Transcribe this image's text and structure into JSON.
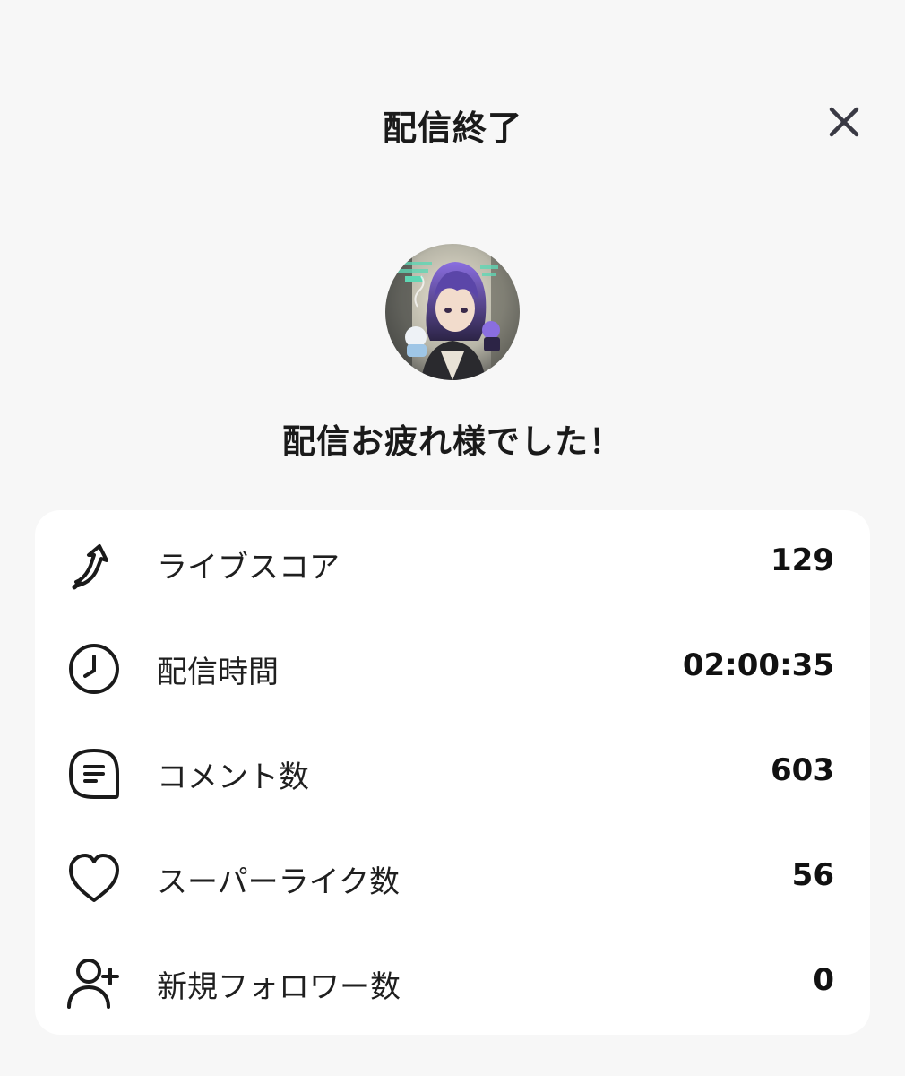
{
  "header": {
    "title": "配信終了",
    "close_icon": "close-icon"
  },
  "avatar": {
    "description_icon": "avatar-image",
    "colors": [
      "#7b5fd6",
      "#2b2440",
      "#c9d8d0",
      "#e9e4d6"
    ]
  },
  "message": "配信お疲れ様でした！",
  "stats": [
    {
      "icon": "live-score-arrow-icon",
      "label": "ライブスコア",
      "value": "129"
    },
    {
      "icon": "clock-icon",
      "label": "配信時間",
      "value": "02:00:35"
    },
    {
      "icon": "comment-icon",
      "label": "コメント数",
      "value": "603"
    },
    {
      "icon": "heart-icon",
      "label": "スーパーライク数",
      "value": "56"
    },
    {
      "icon": "add-user-icon",
      "label": "新規フォロワー数",
      "value": "0"
    }
  ],
  "colors": {
    "background": "#f7f7f7",
    "card": "#ffffff",
    "text": "#1a1a1a",
    "icon_stroke": "#1a1a1a"
  }
}
